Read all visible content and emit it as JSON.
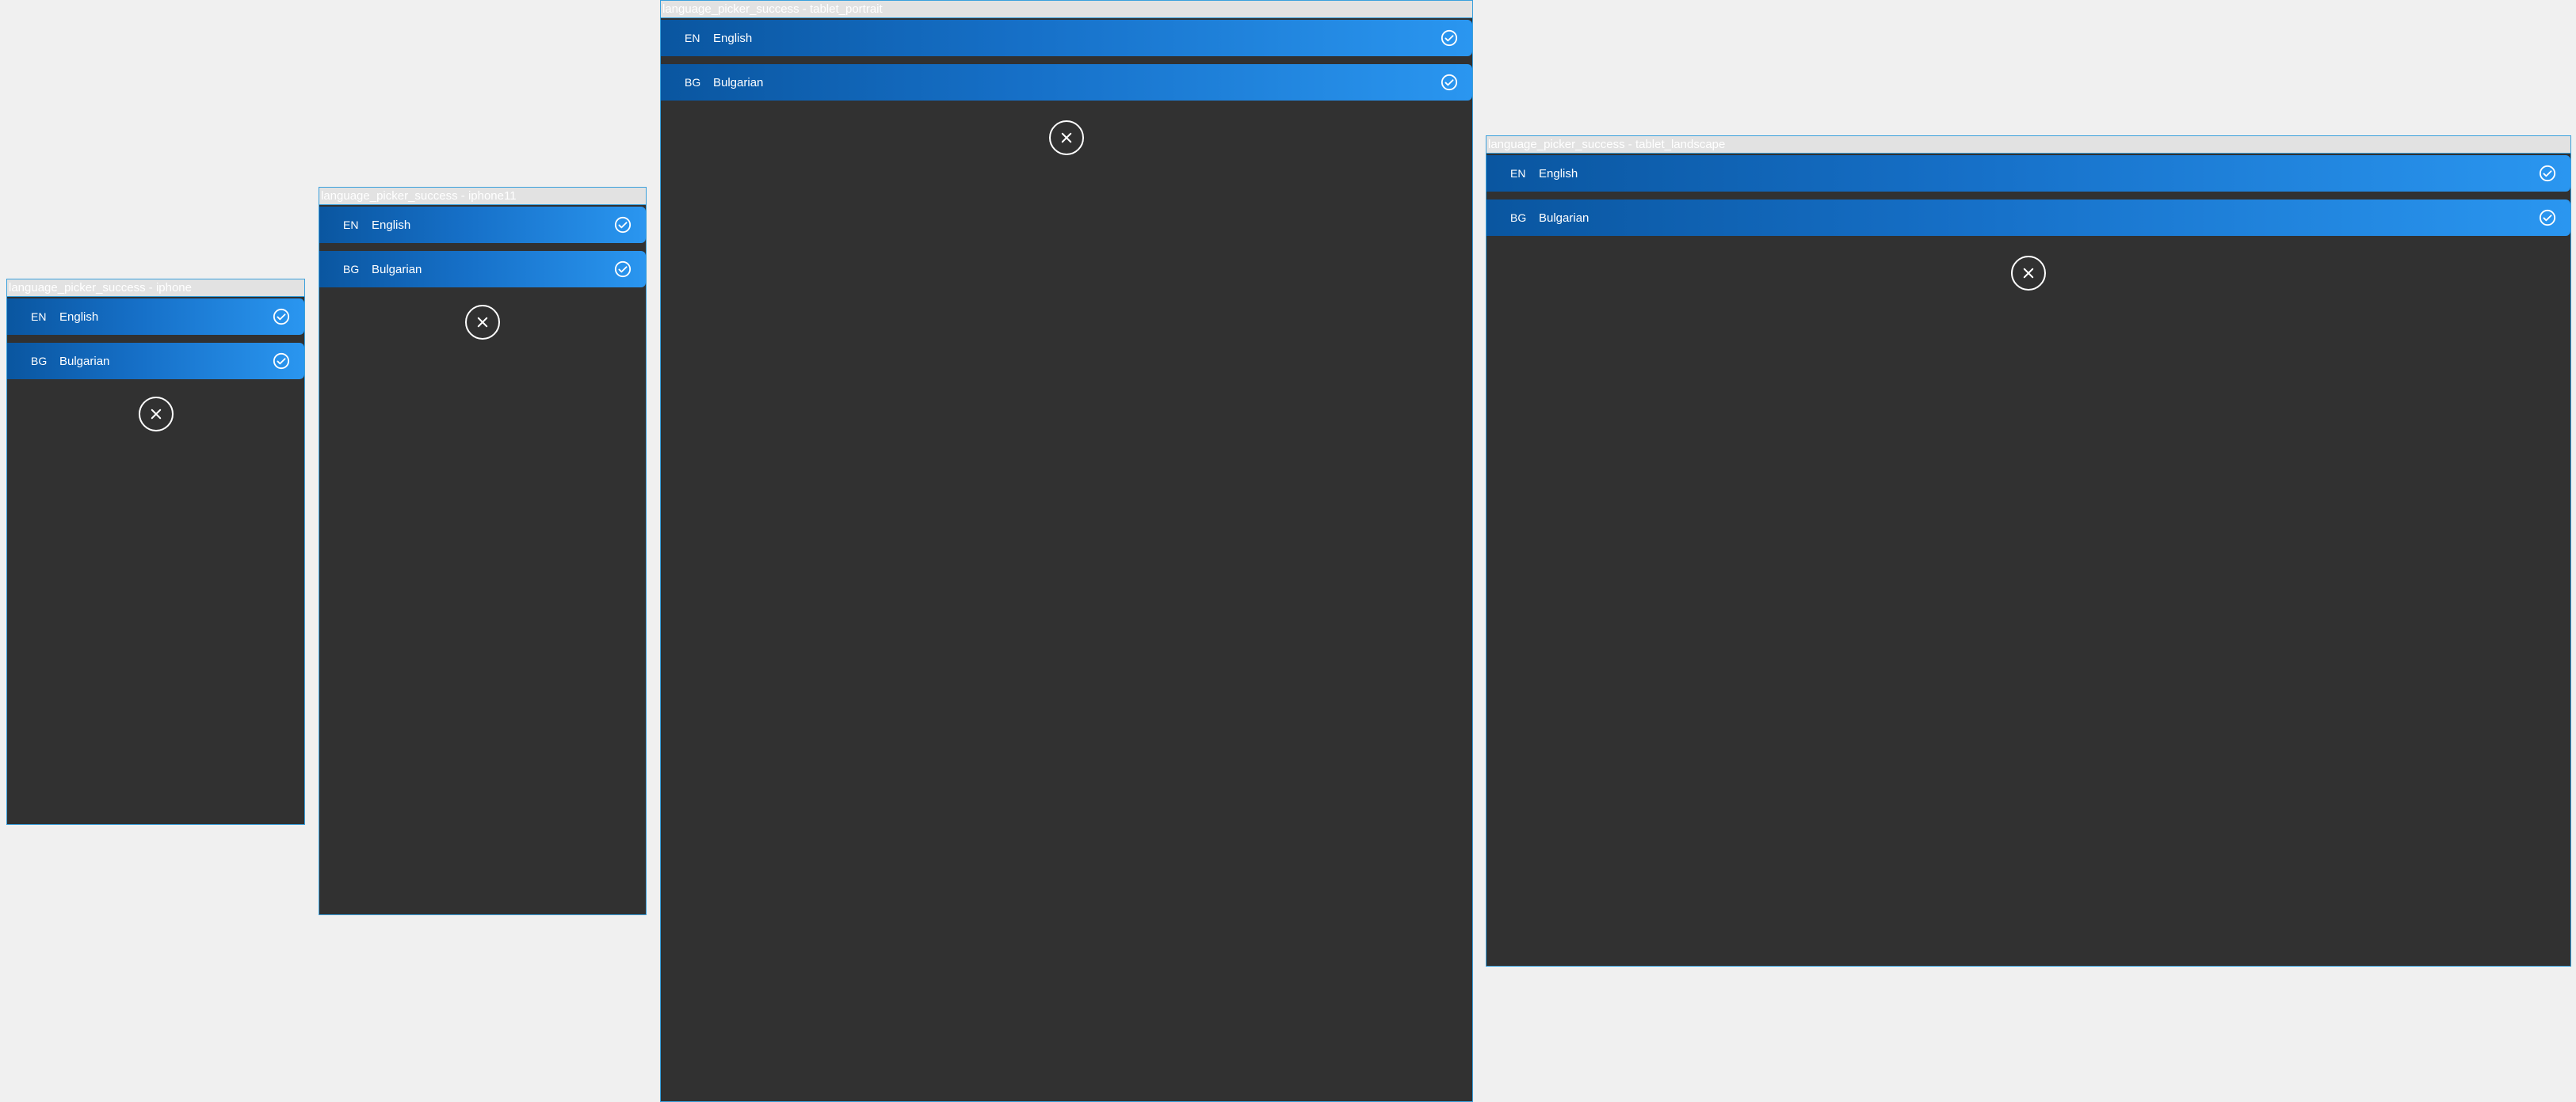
{
  "frames": [
    {
      "title": "language_picker_success - iphone",
      "languages": [
        {
          "code": "EN",
          "name": "English"
        },
        {
          "code": "BG",
          "name": "Bulgarian"
        }
      ]
    },
    {
      "title": "language_picker_success - iphone11",
      "languages": [
        {
          "code": "EN",
          "name": "English"
        },
        {
          "code": "BG",
          "name": "Bulgarian"
        }
      ]
    },
    {
      "title": "language_picker_success - tablet_portrait",
      "languages": [
        {
          "code": "EN",
          "name": "English"
        },
        {
          "code": "BG",
          "name": "Bulgarian"
        }
      ]
    },
    {
      "title": "language_picker_success - tablet_landscape",
      "languages": [
        {
          "code": "EN",
          "name": "English"
        },
        {
          "code": "BG",
          "name": "Bulgarian"
        }
      ]
    }
  ],
  "icons": {
    "selected": "check-circle-icon",
    "close": "close-icon"
  },
  "colors": {
    "background": "#313131",
    "frame_border": "#3aa0dc",
    "row_gradient_start": "#0a56a0",
    "row_gradient_end": "#2a96f0",
    "text": "#ffffff"
  }
}
